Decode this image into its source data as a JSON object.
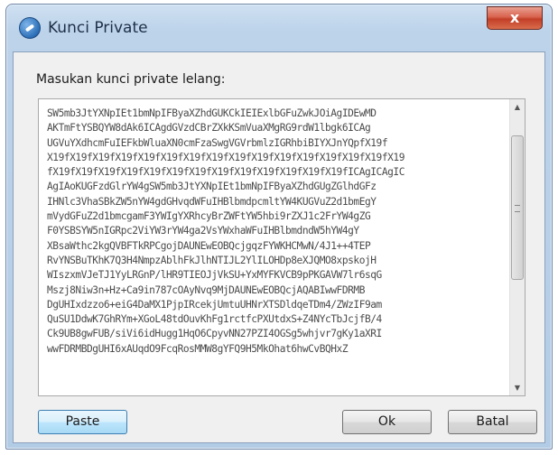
{
  "window": {
    "title": "Kunci Private",
    "close_label": "x",
    "icon": "app-globe-icon"
  },
  "dialog": {
    "prompt": "Masukan kunci private lelang:",
    "text_lines": [
      "SW5mb3JtYXNpIEt1bmNpIFByaXZhdGUKCkIEIExlbGFuZwkJOiAgIDEwMD",
      "AKTmFtYSBQYW8dAk6ICAgdGVzdCBrZXkKSmVuaXMgRG9rdW1lbgk6ICAg",
      "UGVuYXdhcmFuIEFkbWluaXN0cmFzaSwgVGVrbmlzIGRhbiBIYXJnYQpfX19f",
      "X19fX19fX19fX19fX19fX19fX19fX19fX19fX19fX19fX19fX19fX19fX19fX19",
      "fX19fX19fX19fX19fX19fX19fX19fX19fX19fX19fX19fX19fX19fICAgICAgIC",
      "AgIAoKUGFzdGlrYW4gSW5mb3JtYXNpIEt1bmNpIFByaXZhdGUgZGlhdGFz",
      "IHNlc3VhaSBkZW5nYW4gdGHvqdWFuIHBlbmdpcmltYW4KUGVuZ2d1bmEgY",
      "mVydGFuZ2d1bmcgamF3YWIgYXRhcyBrZWFtYW5hbi9rZXJ1c2FrYW4gZG",
      "F0YSBSYW5nIGRpc2ViYW3rYW4ga2VsYWxhaWFuIHBlbmdndW5hYW4gY",
      "XBsaWthc2kgQVBFTkRPCgojDAUNEwEOBQcjgqzFYWKHCMwN/4J1++4TEP",
      "RvYNSBuTKhK7Q3H4NmpzAblhFkJlhNTIJL2YlILOHDp8eXJQMO8xpskojH",
      "WIszxmVJeTJ1YyLRGnP/lHR9TIEOJjVkSU+YxMYFKVCB9pPKGAVW7lr6sqG",
      "Mszj8Niw3n+Hz+Ca9in787cOAyNvq9MjDAUNEwEOBQcjAQABIwwFDRMB",
      "DgUHIxdzzo6+eiG4DaMX1PjpIRcekjUmtuUHNrXTSDldqeTDm4/ZWzIF9am",
      "QuSU1DdwK7GhRYm+XGoL48tdOuvKhFg1rctfcPXUtdxS+Z4NYcTbJcjfB/4",
      "Ck9UB8gwFUB/siVi6idHugg1HqO6CpyvNN27PZI4OGSg5whjvr7gKy1aXRI",
      "wwFDRMBDgUHI6xAUqdO9FcqRosMMW8gYFQ9H5MkOhat6hwCvBQHxZ"
    ],
    "buttons": {
      "paste": "Paste",
      "ok": "Ok",
      "cancel": "Batal"
    }
  }
}
